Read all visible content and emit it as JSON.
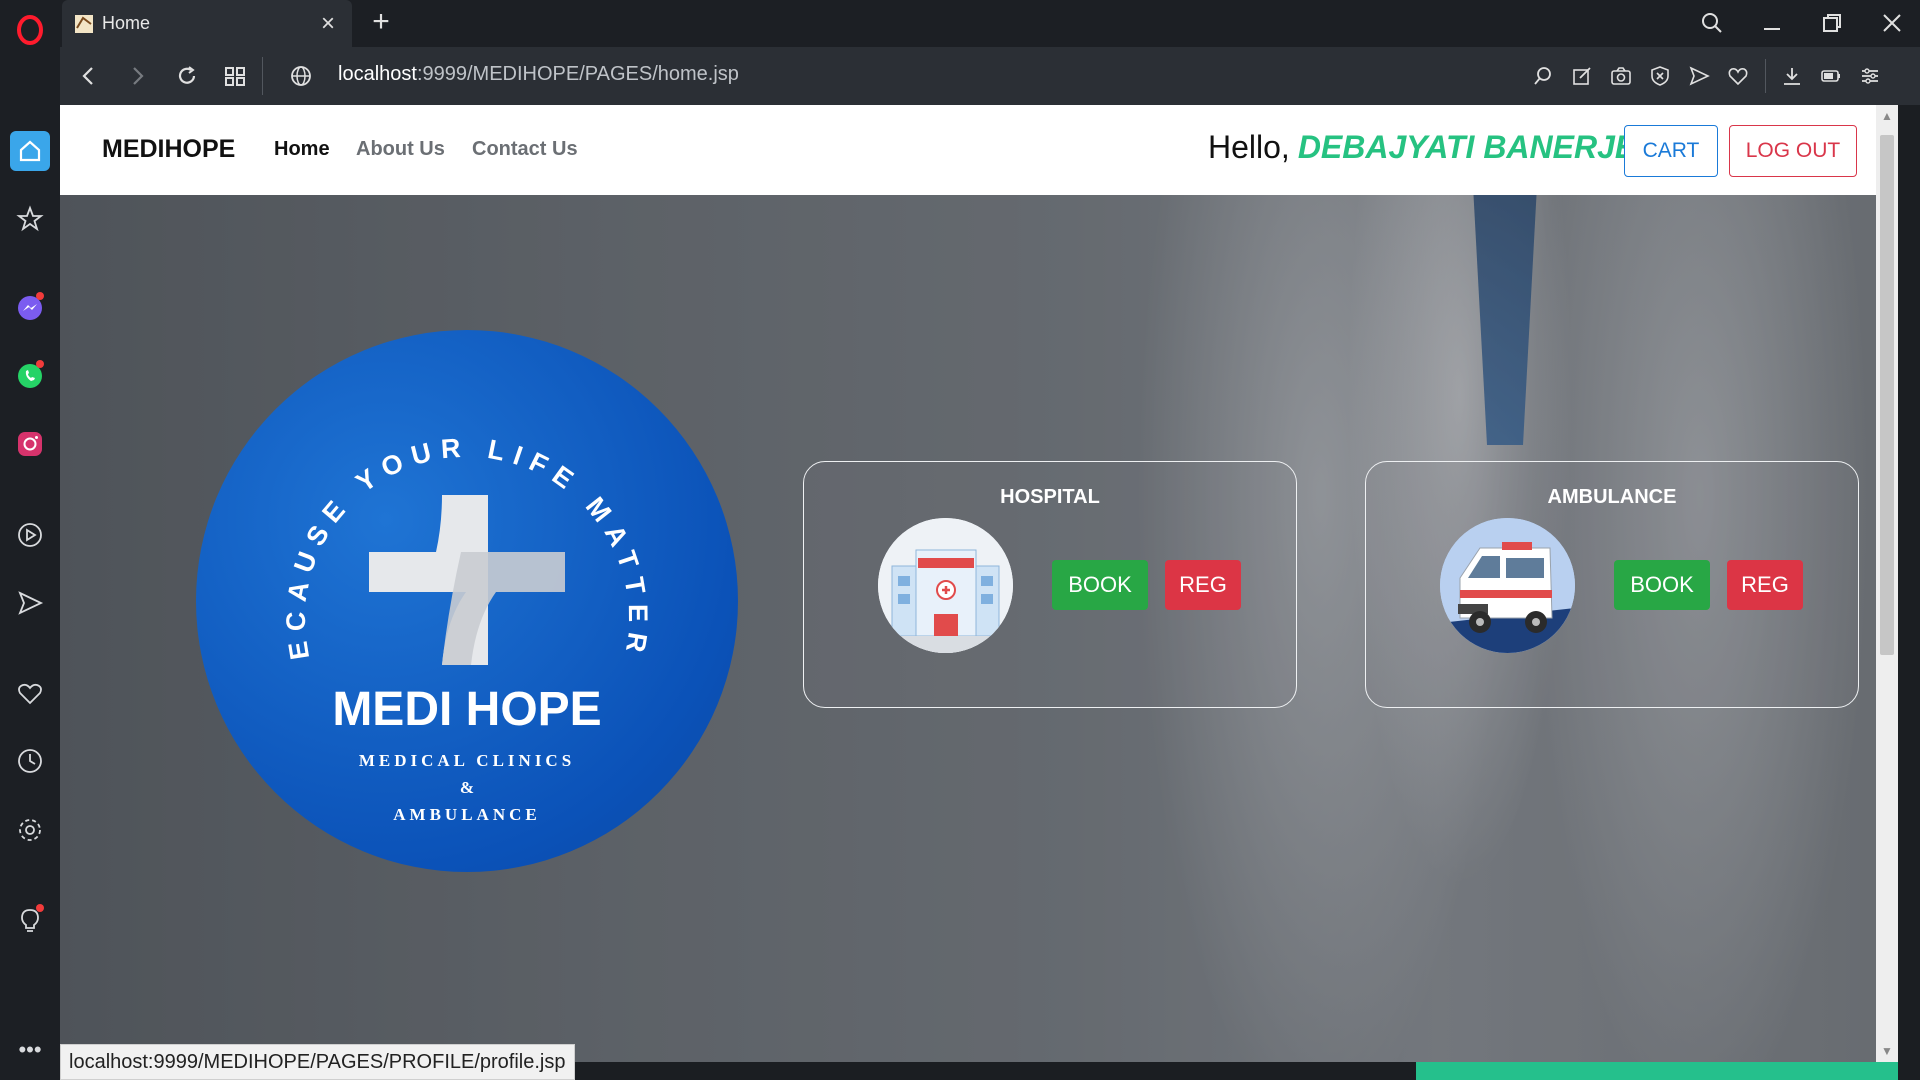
{
  "browser": {
    "tab": {
      "title": "Home"
    },
    "address": {
      "host": "localhost",
      "rest": ":9999/MEDIHOPE/PAGES/home.jsp"
    },
    "status_url": "localhost:9999/MEDIHOPE/PAGES/PROFILE/profile.jsp",
    "sidebar_icons": [
      "opera-logo-icon",
      "home-icon",
      "star-icon",
      "messenger-icon",
      "whatsapp-icon",
      "instagram-icon",
      "player-icon",
      "send-icon",
      "heart-icon",
      "history-icon",
      "settings-icon",
      "lightbulb-icon",
      "more-icon"
    ]
  },
  "navbar": {
    "brand": "MEDIHOPE",
    "links": [
      "Home",
      "About Us",
      "Contact Us"
    ],
    "greeting": "Hello,",
    "user_name": "DEBAJYATI BANERJEE",
    "cart_label": "CART",
    "logout_label": "LOG OUT"
  },
  "logo": {
    "arc_text": "BECAUSE YOUR LIFE MATTERS",
    "name": "MEDI HOPE",
    "line1": "MEDICAL CLINICS",
    "line2": "&",
    "line3": "AMBULANCE"
  },
  "cards": [
    {
      "title": "HOSPITAL",
      "book": "BOOK",
      "reg": "REG"
    },
    {
      "title": "AMBULANCE",
      "book": "BOOK",
      "reg": "REG"
    }
  ],
  "colors": {
    "accent_green": "#28a745",
    "accent_red": "#dc3545",
    "username_green": "#26c281",
    "logo_blue": "#0b52b8"
  }
}
